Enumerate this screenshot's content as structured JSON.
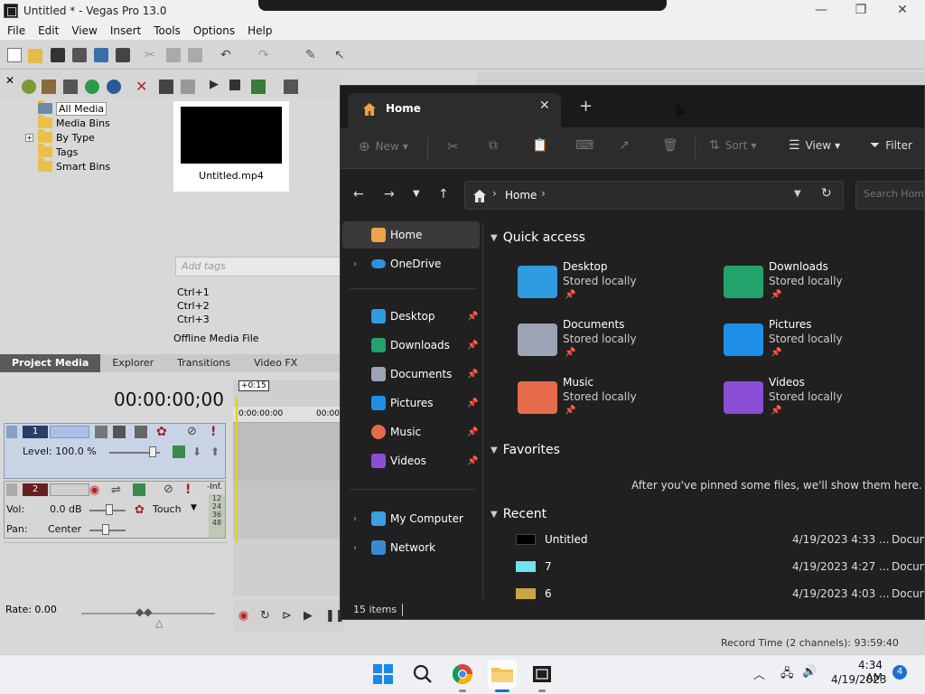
{
  "vegas": {
    "title": "Untitled * - Vegas Pro 13.0",
    "menu": [
      "File",
      "Edit",
      "View",
      "Insert",
      "Tools",
      "Options",
      "Help"
    ],
    "tree": [
      {
        "label": "All Media",
        "selected": true
      },
      {
        "label": "Media Bins"
      },
      {
        "label": "By Type",
        "expandable": true
      },
      {
        "label": "Tags"
      },
      {
        "label": "Smart Bins"
      }
    ],
    "media_file": "Untitled.mp4",
    "tags_placeholder": "Add tags",
    "shortcuts": [
      "Ctrl+1",
      "Ctrl+2",
      "Ctrl+3"
    ],
    "offline_label": "Offline Media File",
    "tabs": [
      "Project Media",
      "Explorer",
      "Transitions",
      "Video FX"
    ],
    "timecode": "00:00:00;00",
    "timecode_badge": "+0:15",
    "ruler_start": "0:00:00:00",
    "ruler_next": "00:00",
    "video_track": {
      "number": "1",
      "level": "Level: 100.0 %"
    },
    "audio_track": {
      "number": "2",
      "vol_label": "Vol:",
      "vol_value": "0.0 dB",
      "pan_label": "Pan:",
      "pan_value": "Center",
      "mode": "Touch",
      "meter_top": "-Inf.",
      "meter_ticks": [
        "12",
        "24",
        "36",
        "48"
      ]
    },
    "rate": "Rate: 0.00",
    "record_time": "Record Time (2 channels): 93:59:40"
  },
  "explorer": {
    "tab_label": "Home",
    "commands": {
      "new": "New",
      "sort": "Sort",
      "view": "View",
      "filter": "Filter"
    },
    "address_crumb": "Home",
    "search_placeholder": "Search Home",
    "nav": {
      "home": "Home",
      "onedrive": "OneDrive",
      "pinned": [
        "Desktop",
        "Downloads",
        "Documents",
        "Pictures",
        "Music",
        "Videos"
      ],
      "my_computer": "My Computer",
      "network": "Network"
    },
    "quick_access_header": "Quick access",
    "quick_access": [
      {
        "name": "Desktop",
        "sub": "Stored locally",
        "color": "#2f9be0"
      },
      {
        "name": "Downloads",
        "sub": "Stored locally",
        "color": "#23a36b"
      },
      {
        "name": "Documents",
        "sub": "Stored locally",
        "color": "#9aa4b5"
      },
      {
        "name": "Pictures",
        "sub": "Stored locally",
        "color": "#1f8fe6"
      },
      {
        "name": "Music",
        "sub": "Stored locally",
        "color": "#e56b4a"
      },
      {
        "name": "Videos",
        "sub": "Stored locally",
        "color": "#8a4fd6"
      }
    ],
    "favorites_header": "Favorites",
    "favorites_empty": "After you've pinned some files, we'll show them here.",
    "recent_header": "Recent",
    "recent": [
      {
        "name": "Untitled",
        "date": "4/19/2023 4:33 ...",
        "type": "Docum"
      },
      {
        "name": "7",
        "date": "4/19/2023 4:27 ...",
        "type": "Docum"
      },
      {
        "name": "6",
        "date": "4/19/2023 4:03 ...",
        "type": "Docum"
      }
    ],
    "status_count": "15 items"
  },
  "taskbar": {
    "time": "4:34 AM",
    "date": "4/19/2023",
    "notifications": "4"
  }
}
